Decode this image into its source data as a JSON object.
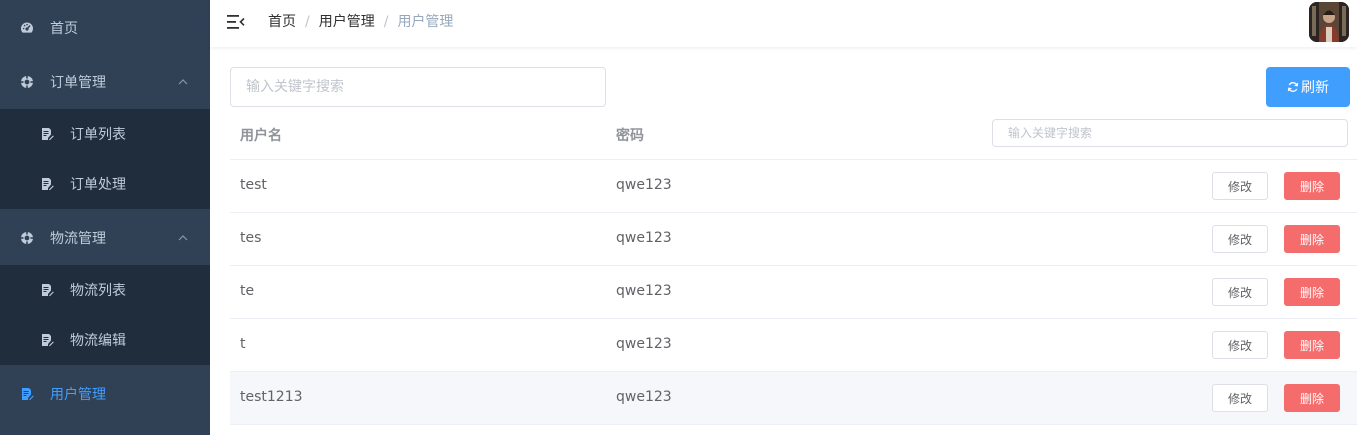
{
  "sidebar": {
    "items": [
      {
        "label": "首页",
        "icon": "dashboard-icon"
      },
      {
        "label": "订单管理",
        "icon": "settings-icon",
        "expanded": true
      },
      {
        "label": "订单列表",
        "icon": "document-edit-icon"
      },
      {
        "label": "订单处理",
        "icon": "document-edit-icon"
      },
      {
        "label": "物流管理",
        "icon": "settings-icon",
        "expanded": true
      },
      {
        "label": "物流列表",
        "icon": "document-edit-icon"
      },
      {
        "label": "物流编辑",
        "icon": "document-edit-icon"
      },
      {
        "label": "用户管理",
        "icon": "document-edit-icon",
        "active": true
      }
    ]
  },
  "header": {
    "breadcrumb": [
      "首页",
      "用户管理",
      "用户管理"
    ],
    "separator": "/"
  },
  "toolbar": {
    "search_placeholder": "输入关键字搜索",
    "refresh_label": "刷新"
  },
  "table": {
    "columns": [
      "用户名",
      "密码"
    ],
    "search_placeholder": "输入关键字搜索",
    "edit_label": "修改",
    "delete_label": "删除",
    "rows": [
      {
        "username": "test",
        "password": "qwe123"
      },
      {
        "username": "tes",
        "password": "qwe123"
      },
      {
        "username": "te",
        "password": "qwe123"
      },
      {
        "username": "t",
        "password": "qwe123"
      },
      {
        "username": "test1213",
        "password": "qwe123"
      }
    ]
  },
  "colors": {
    "sidebar_bg": "#304156",
    "submenu_bg": "#1f2d3d",
    "accent": "#409eff",
    "danger": "#f56c6c"
  }
}
